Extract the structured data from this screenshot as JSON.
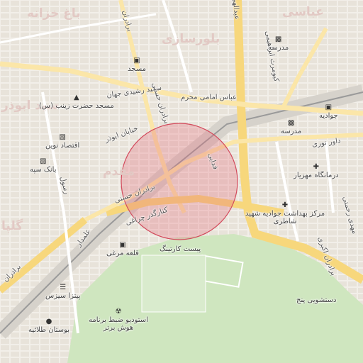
{
  "map": {
    "highlight_color": "#e66a7a",
    "park_color": "#cfe6bf",
    "major_road_color": "#f7d77c",
    "rail_color": "#9a9a9a"
  },
  "areas": {
    "bagh_khazaneh": "باغ خزانه",
    "abbasi": "عباسی",
    "bolursazi": "بلورسازی",
    "seyyed_abu_zar": "سید ابوذر",
    "moghadam": "مقدم",
    "golpa": "گلپا"
  },
  "roads": {
    "saeed_rashidi": "سعید رشیدی جهان",
    "abbas_emami": "عباس امامی محرم",
    "baradaran_hasani": "برادران حسنی",
    "khiaban_abuzar": "خیابان ابوذر",
    "baradaran_hasani_2": "برادران حسنی",
    "kamarband_cheraghi": "کنارگذر چراغی",
    "fadaei": "فدایی",
    "kiumars_ebrahimi": "کیومرث ابراهیمی",
    "daver_noori": "داور نوری",
    "baradaran_akbari": "برادران اکبری",
    "mehdi_rahmati": "مهدی رحمتی",
    "oboozar_top": "برادران",
    "abdollahi": "عبدالهی",
    "zakeri": "برادران",
    "alamdar": "علمدار",
    "rasool": "رسول"
  },
  "pois": {
    "mosque_1": "مسجد",
    "madreseh_1": "مدرسه",
    "masjed_hazrat_zeinab": "مسجد حضرت زینب (س)",
    "javadieh_station": "جوادیه",
    "madreseh_2": "مدرسه",
    "eghtesad_novin": "اقتصاد نوین",
    "bank_sepah": "بانک سپه",
    "darmangah_mahziar": "درمانگاه مهزیار",
    "markaz_behdasht": "مرکز بهداشت جوادیه شهید شاطری",
    "ghaleh_morghi": "قلعه مرغی",
    "pist_karting": "پیست کارتینگ",
    "pizza_sizez": "پیتزا سیزس",
    "studio_zabt": "استودیو ضبط برنامه هوش برتر",
    "dashtshooyi_panj": "دستشویی پنج",
    "bustan_talaieh": "بوستان طلائیه"
  },
  "icons": {
    "bus": "bus-icon",
    "school": "school-icon",
    "mosque": "mosque-icon",
    "rail": "train-icon",
    "bank": "bank-icon",
    "clinic": "clinic-icon",
    "cinema": "studio-icon",
    "pizza": "restaurant-icon"
  }
}
